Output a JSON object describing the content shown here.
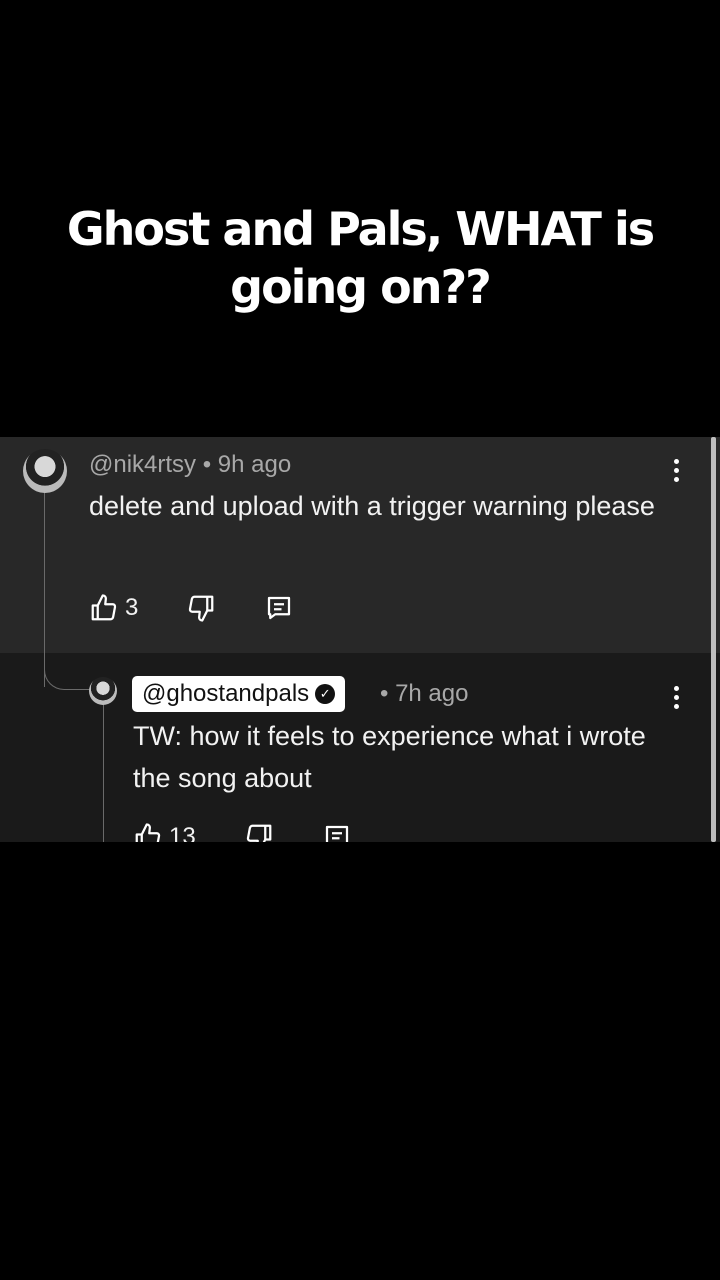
{
  "caption": {
    "line1": "Ghost and Pals, WHAT is",
    "line2": "going on??"
  },
  "comments": [
    {
      "username": "@nik4rtsy",
      "time": "• 9h ago",
      "text": "delete and upload with a trigger warning please",
      "likes": "3"
    },
    {
      "username": "@ghostandpals",
      "time": "• 7h ago",
      "text": "TW: how it feels to experience what i wrote the song about",
      "likes": "13",
      "verified": true
    }
  ],
  "icons": [
    "thumbs-up-icon",
    "thumbs-down-icon",
    "reply-icon",
    "more-options-icon",
    "verified-icon"
  ],
  "colors": {
    "background": "#000000",
    "comment_bg": "#282828",
    "reply_bg": "#1a1a1a",
    "meta_text": "#a8a8a8"
  }
}
